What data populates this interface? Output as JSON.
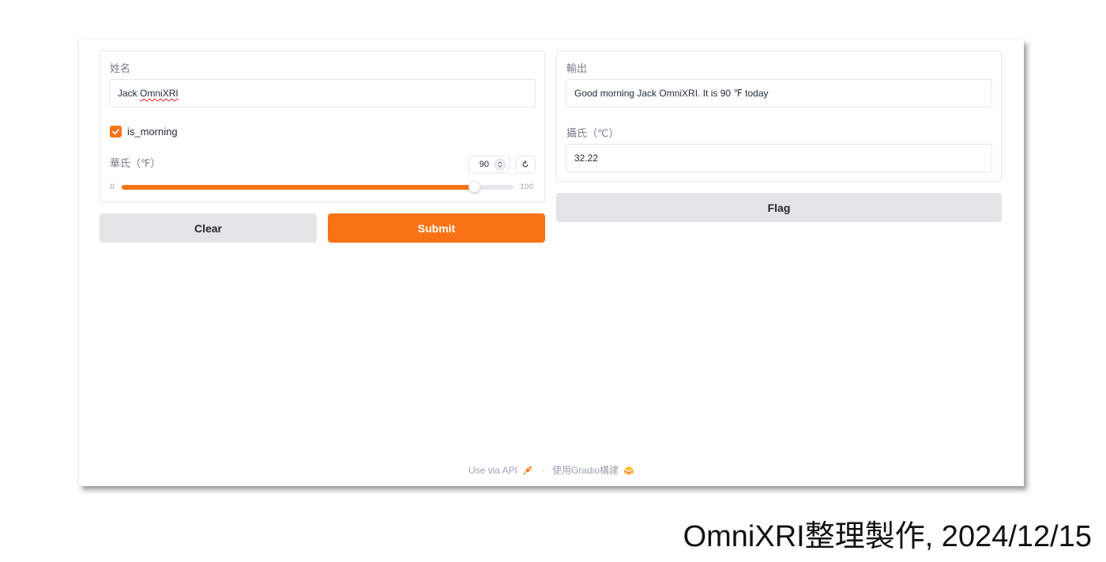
{
  "inputs": {
    "name_label": "姓名",
    "name_value_first": "Jack",
    "name_value_second": "OmniXRI",
    "is_morning_label": "is_morning",
    "is_morning_checked": true,
    "fahrenheit_label": "華氏（℉）",
    "fahrenheit_value": "90",
    "slider_min": "0",
    "slider_max": "100",
    "slider_fraction": 0.9
  },
  "outputs": {
    "output_label": "輸出",
    "output_value": "Good morning Jack OmniXRI. It is 90 ℉ today",
    "celsius_label": "攝氏（℃）",
    "celsius_value": "32.22"
  },
  "buttons": {
    "clear_label": "Clear",
    "submit_label": "Submit",
    "flag_label": "Flag"
  },
  "footer": {
    "api_label": "Use via API",
    "separator": "·",
    "built_with": "使用Gradio構建"
  },
  "watermark": "OmniXRI整理製作, 2024/12/15",
  "colors": {
    "accent": "#f97316",
    "secondary_button": "#e4e4e7",
    "border": "#e5e7eb"
  },
  "icons": [
    "check-icon",
    "spinner-arrows-icon",
    "reset-icon",
    "rocket-icon",
    "gradio-logo-icon"
  ]
}
